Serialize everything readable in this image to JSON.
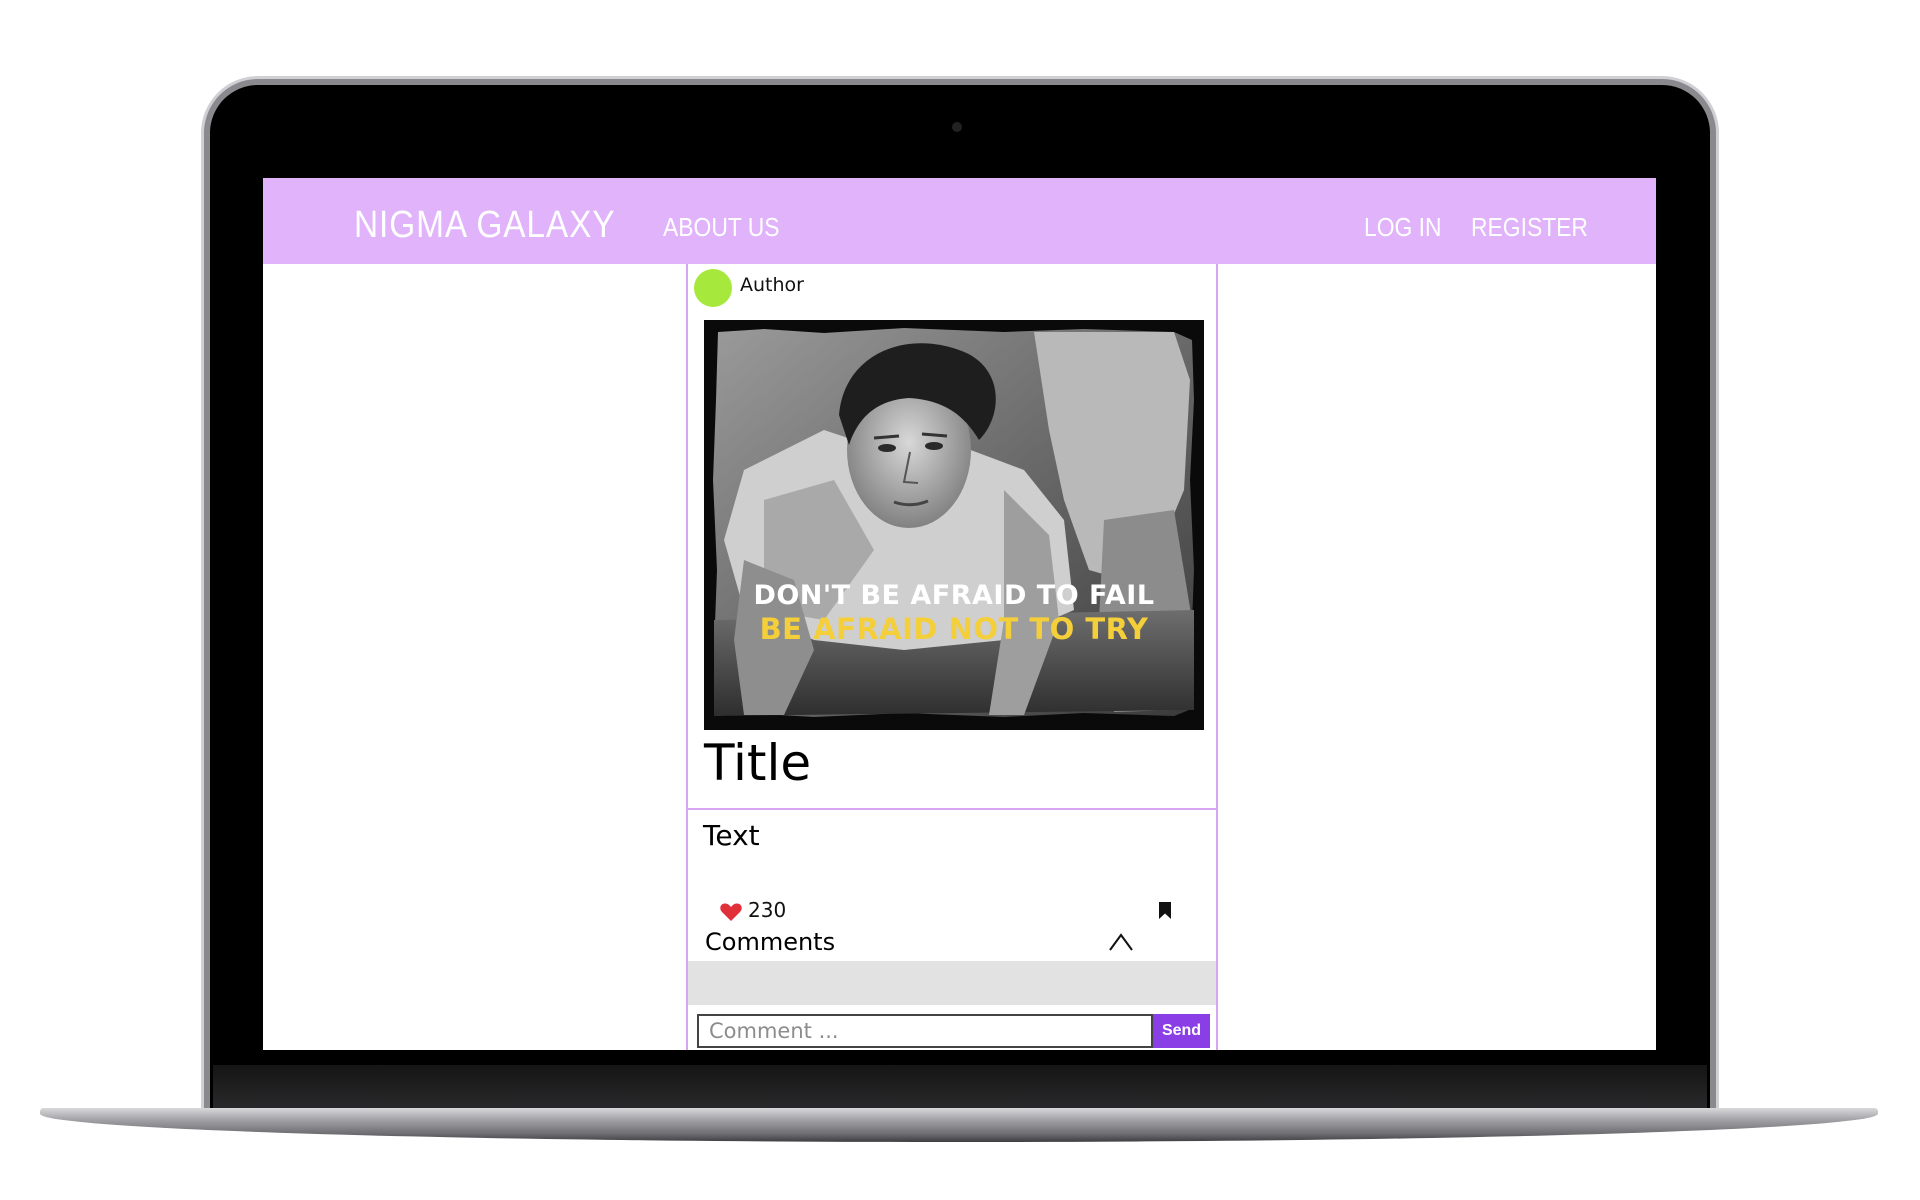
{
  "navbar": {
    "brand": "NIGMA GALAXY",
    "about": "ABOUT US",
    "login": "LOG IN",
    "register": "REGISTER",
    "background": "#e0b3fa"
  },
  "post": {
    "author": "Author",
    "image": {
      "caption_line1": "DON'T BE AFRAID TO FAIL",
      "caption_line2": "BE AFRAID NOT TO TRY"
    },
    "title": "Title",
    "text": "Text",
    "likes": "230",
    "comments_label": "Comments"
  },
  "comment_form": {
    "placeholder": "Comment ...",
    "send_label": "Send"
  },
  "icons": {
    "like": "heart-icon",
    "save": "bookmark-icon",
    "toggle": "chevron-up-icon"
  },
  "colors": {
    "accent": "#8a3fe6",
    "avatar": "#a6e83b",
    "heart": "#e0303a",
    "caption_highlight": "#f4cf3a"
  }
}
